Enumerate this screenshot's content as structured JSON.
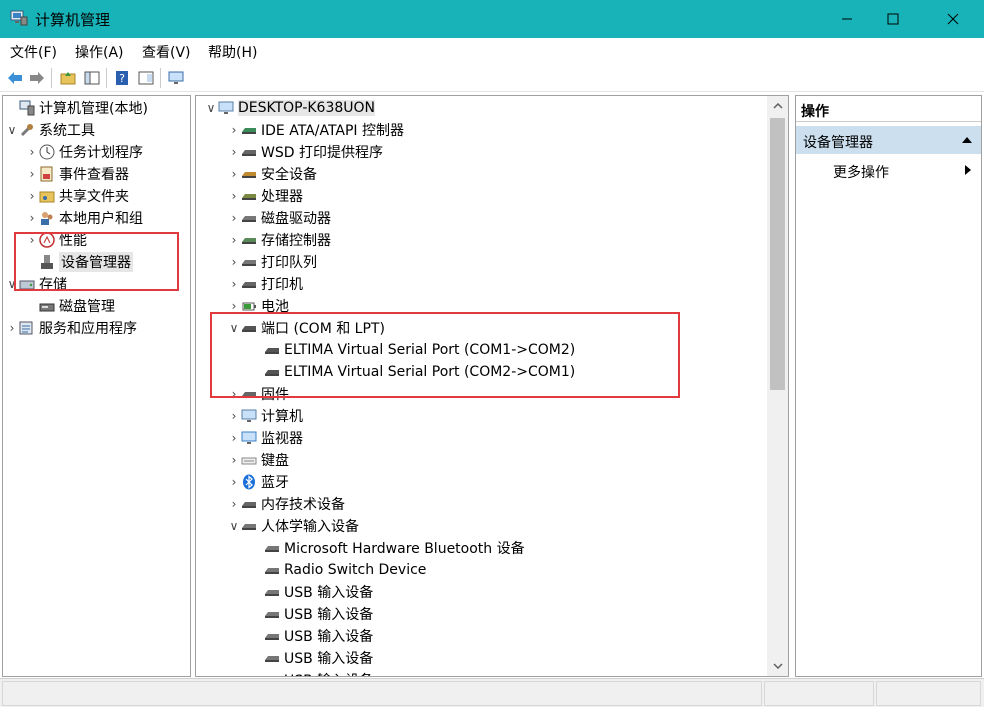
{
  "window": {
    "title": "计算机管理",
    "titlebar_color": "#17b3b9"
  },
  "menu": [
    "文件(F)",
    "操作(A)",
    "查看(V)",
    "帮助(H)"
  ],
  "toolbar_icons": [
    "back-arrow-icon",
    "forward-arrow-icon",
    "up-folder-icon",
    "show-hide-tree-icon",
    "help-icon",
    "console-view-icon",
    "monitor-icon"
  ],
  "left_tree": [
    {
      "label": "计算机管理(本地)",
      "chev": "",
      "icon": "computer-management-icon"
    },
    {
      "label": "系统工具",
      "chev": "∨",
      "icon": "tools-icon"
    },
    {
      "label": "任务计划程序",
      "chev": "›",
      "icon": "clock-icon"
    },
    {
      "label": "事件查看器",
      "chev": "›",
      "icon": "event-viewer-icon"
    },
    {
      "label": "共享文件夹",
      "chev": "›",
      "icon": "shared-folder-icon"
    },
    {
      "label": "本地用户和组",
      "chev": "›",
      "icon": "users-icon"
    },
    {
      "label": "性能",
      "chev": "›",
      "icon": "performance-icon"
    },
    {
      "label": "设备管理器",
      "chev": "",
      "icon": "device-manager-icon"
    },
    {
      "label": "存储",
      "chev": "∨",
      "icon": "storage-icon"
    },
    {
      "label": "磁盘管理",
      "chev": "",
      "icon": "disk-management-icon"
    },
    {
      "label": "服务和应用程序",
      "chev": "›",
      "icon": "services-icon"
    }
  ],
  "device_tree": [
    {
      "label": "DESKTOP-K638UON",
      "chev": "∨",
      "icon": "computer-icon"
    },
    {
      "label": "IDE ATA/ATAPI 控制器",
      "chev": "›",
      "icon": "ide-controller-icon"
    },
    {
      "label": "WSD 打印提供程序",
      "chev": "›",
      "icon": "printer-icon"
    },
    {
      "label": "安全设备",
      "chev": "›",
      "icon": "security-device-icon"
    },
    {
      "label": "处理器",
      "chev": "›",
      "icon": "processor-icon"
    },
    {
      "label": "磁盘驱动器",
      "chev": "›",
      "icon": "disk-drive-icon"
    },
    {
      "label": "存储控制器",
      "chev": "›",
      "icon": "storage-controller-icon"
    },
    {
      "label": "打印队列",
      "chev": "›",
      "icon": "print-queue-icon"
    },
    {
      "label": "打印机",
      "chev": "›",
      "icon": "printer-icon"
    },
    {
      "label": "电池",
      "chev": "›",
      "icon": "battery-icon"
    },
    {
      "label": "端口 (COM 和 LPT)",
      "chev": "∨",
      "icon": "port-icon"
    },
    {
      "label": "ELTIMA Virtual Serial Port (COM1->COM2)",
      "chev": "",
      "icon": "port-icon"
    },
    {
      "label": "ELTIMA Virtual Serial Port (COM2->COM1)",
      "chev": "",
      "icon": "port-icon"
    },
    {
      "label": "固件",
      "chev": "›",
      "icon": "firmware-icon"
    },
    {
      "label": "计算机",
      "chev": "›",
      "icon": "computer-icon"
    },
    {
      "label": "监视器",
      "chev": "›",
      "icon": "monitor-icon"
    },
    {
      "label": "键盘",
      "chev": "›",
      "icon": "keyboard-icon"
    },
    {
      "label": "蓝牙",
      "chev": "›",
      "icon": "bluetooth-icon"
    },
    {
      "label": "内存技术设备",
      "chev": "›",
      "icon": "memory-device-icon"
    },
    {
      "label": "人体学输入设备",
      "chev": "∨",
      "icon": "hid-icon"
    },
    {
      "label": "Microsoft Hardware Bluetooth 设备",
      "chev": "",
      "icon": "hid-icon"
    },
    {
      "label": "Radio Switch Device",
      "chev": "",
      "icon": "hid-icon"
    },
    {
      "label": "USB 输入设备",
      "chev": "",
      "icon": "hid-icon"
    },
    {
      "label": "USB 输入设备",
      "chev": "",
      "icon": "hid-icon"
    },
    {
      "label": "USB 输入设备",
      "chev": "",
      "icon": "hid-icon"
    },
    {
      "label": "USB 输入设备",
      "chev": "",
      "icon": "hid-icon"
    },
    {
      "label": "USB 输入设备",
      "chev": "",
      "icon": "hid-icon"
    }
  ],
  "actions": {
    "header": "操作",
    "section": "设备管理器",
    "more": "更多操作"
  },
  "colors": {
    "highlight_box": "#e0393e",
    "action_section_bg": "#ccdfef"
  }
}
